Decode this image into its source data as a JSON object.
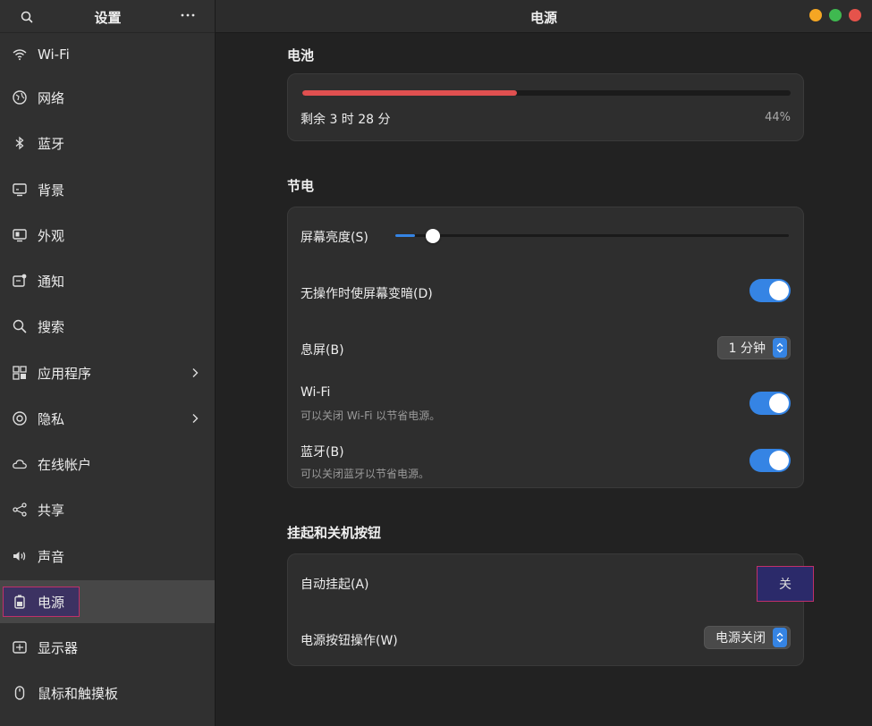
{
  "sidebar": {
    "title": "设置",
    "items": [
      {
        "label": "Wi-Fi",
        "icon": "wifi-icon"
      },
      {
        "label": "网络",
        "icon": "network-icon"
      },
      {
        "label": "蓝牙",
        "icon": "bluetooth-icon"
      },
      {
        "label": "背景",
        "icon": "background-icon"
      },
      {
        "label": "外观",
        "icon": "appearance-icon"
      },
      {
        "label": "通知",
        "icon": "notification-icon"
      },
      {
        "label": "搜索",
        "icon": "search-icon"
      },
      {
        "label": "应用程序",
        "icon": "apps-icon"
      },
      {
        "label": "隐私",
        "icon": "privacy-icon"
      },
      {
        "label": "在线帐户",
        "icon": "cloud-icon"
      },
      {
        "label": "共享",
        "icon": "share-icon"
      },
      {
        "label": "声音",
        "icon": "sound-icon"
      },
      {
        "label": "电源",
        "icon": "battery-icon"
      },
      {
        "label": "显示器",
        "icon": "display-icon"
      },
      {
        "label": "鼠标和触摸板",
        "icon": "mouse-icon"
      }
    ]
  },
  "header": {
    "title": "电源"
  },
  "window_controls": {
    "minimize_color": "#f5a623",
    "maximize_color": "#3fb950",
    "close_color": "#e5534b"
  },
  "battery": {
    "section_title": "电池",
    "remaining": "剩余 3 时 28 分",
    "percent_label": "44%",
    "level": 0.44,
    "bar_color": "#e05050"
  },
  "power_saving": {
    "section_title": "节电",
    "brightness_label": "屏幕亮度(S)",
    "brightness_level": 0.05,
    "dim_label": "无操作时使屏幕变暗(D)",
    "dim_on": true,
    "blank_label": "息屏(B)",
    "blank_value": "1 分钟",
    "wifi_label": "Wi-Fi",
    "wifi_sub": "可以关闭 Wi-Fi 以节省电源。",
    "wifi_on": true,
    "bt_label": "蓝牙(B)",
    "bt_sub": "可以关闭蓝牙以节省电源。",
    "bt_on": true
  },
  "suspend": {
    "section_title": "挂起和关机按钮",
    "auto_suspend_label": "自动挂起(A)",
    "auto_suspend_value": "关",
    "power_button_label": "电源按钮操作(W)",
    "power_button_value": "电源关闭"
  },
  "accent_color": "#3584e4"
}
